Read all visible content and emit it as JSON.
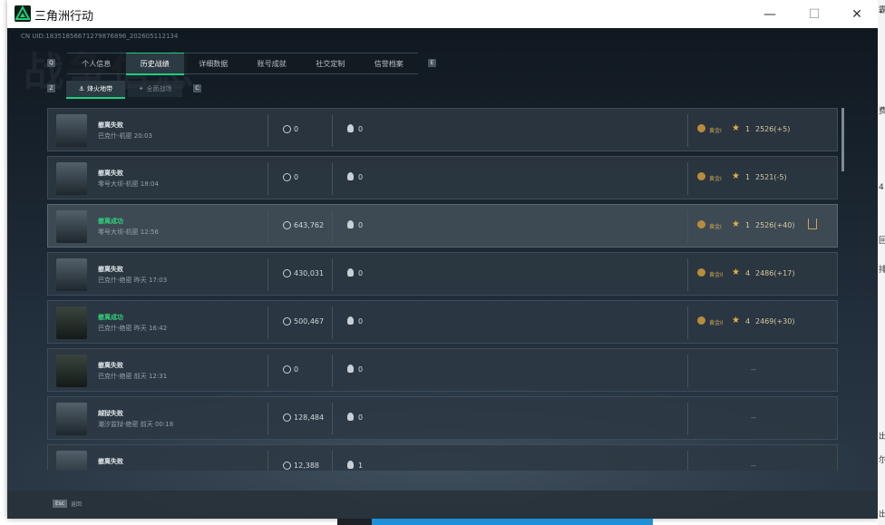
{
  "window": {
    "title": "三角洲行动",
    "minimize": "—",
    "maximize": "☐",
    "close": "✕"
  },
  "uid": "CN UID:18351856671279876896_202605112134",
  "tabs": [
    {
      "label": "个人信息",
      "active": false
    },
    {
      "label": "历史战绩",
      "active": true
    },
    {
      "label": "详细数据",
      "active": false
    },
    {
      "label": "账号成就",
      "active": false
    },
    {
      "label": "社交定制",
      "active": false
    },
    {
      "label": "信誉档案",
      "active": false
    }
  ],
  "hints": {
    "q": "Q",
    "e": "E",
    "z": "Z",
    "c": "C"
  },
  "subtabs": [
    {
      "label": "烽火地带",
      "icon": "extraction-icon"
    },
    {
      "label": "全面战场",
      "icon": "battlefield-icon"
    }
  ],
  "matches": [
    {
      "status": "撤离失败",
      "success": false,
      "map": "巴克什-机密 20:03",
      "value": "0",
      "kills": "0",
      "rank": "黄金I",
      "tier": "1",
      "score": "2526(+5)"
    },
    {
      "status": "撤离失败",
      "success": false,
      "map": "零号大坝-机密 18:04",
      "value": "0",
      "kills": "0",
      "rank": "黄金I",
      "tier": "1",
      "score": "2521(-5)"
    },
    {
      "status": "撤离成功",
      "success": true,
      "map": "零号大坝-机密 12:56",
      "value": "643,762",
      "kills": "0",
      "rank": "黄金I",
      "tier": "1",
      "score": "2526(+40)"
    },
    {
      "status": "撤离失败",
      "success": false,
      "map": "巴克什-绝密 昨天 17:03",
      "value": "430,031",
      "kills": "0",
      "rank": "黄金II",
      "tier": "4",
      "score": "2486(+17)"
    },
    {
      "status": "撤离成功",
      "success": true,
      "map": "巴克什-绝密 昨天 16:42",
      "value": "500,467",
      "kills": "0",
      "rank": "黄金II",
      "tier": "4",
      "score": "2469(+30)"
    },
    {
      "status": "撤离失败",
      "success": false,
      "map": "巴克什-绝密 前天 12:31",
      "value": "0",
      "kills": "0",
      "rank": "",
      "tier": "",
      "score": "--"
    },
    {
      "status": "越狱失败",
      "success": false,
      "map": "潮汐监狱-绝密 前天 00:18",
      "value": "128,484",
      "kills": "0",
      "rank": "",
      "tier": "",
      "score": "--"
    },
    {
      "status": "撤离失败",
      "success": false,
      "map": "",
      "value": "12,388",
      "kills": "1",
      "rank": "",
      "tier": "",
      "score": "--"
    }
  ],
  "footer": {
    "esc": "Esc",
    "back": "返回"
  },
  "background_text": "战争信息",
  "edge_text": [
    "霸",
    "费",
    "4",
    "回",
    "排",
    "出",
    "尔",
    "出"
  ],
  "colors": {
    "accent": "#1bd07c",
    "success": "#33d17a",
    "gold": "#c9a15a"
  }
}
